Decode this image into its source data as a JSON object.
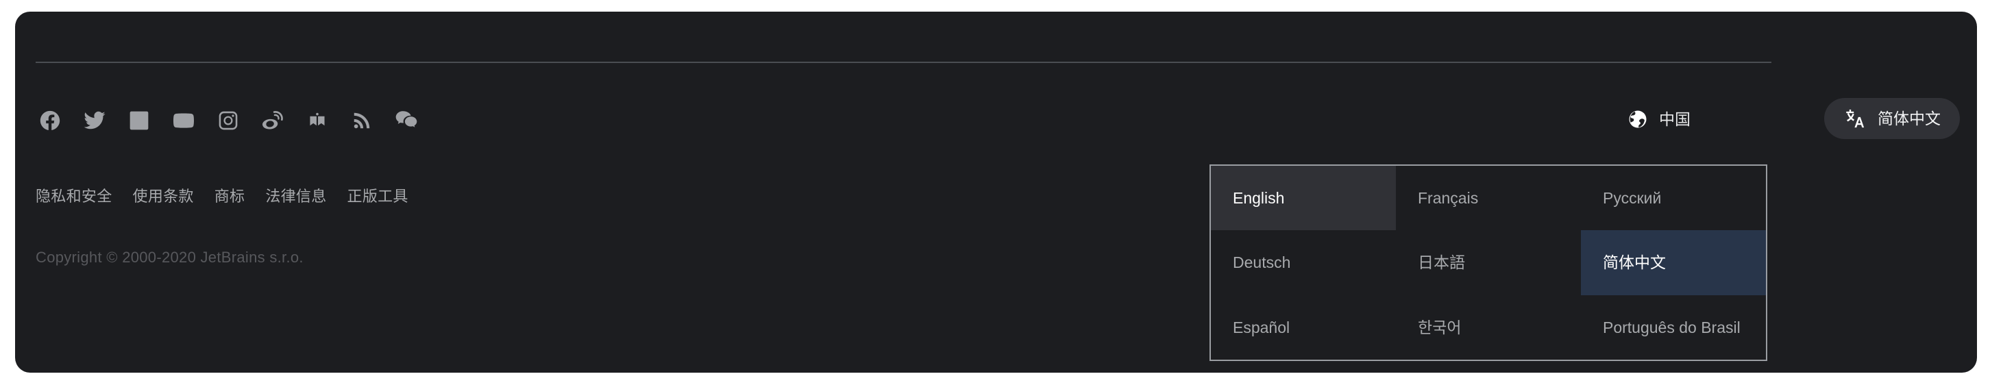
{
  "footer": {
    "social_links": [
      {
        "name": "facebook-icon",
        "label": "Facebook"
      },
      {
        "name": "twitter-icon",
        "label": "Twitter"
      },
      {
        "name": "linkedin-icon",
        "label": "LinkedIn"
      },
      {
        "name": "youtube-icon",
        "label": "YouTube"
      },
      {
        "name": "instagram-icon",
        "label": "Instagram"
      },
      {
        "name": "weibo-icon",
        "label": "Weibo"
      },
      {
        "name": "zhihu-icon",
        "label": "Zhihu"
      },
      {
        "name": "rss-icon",
        "label": "RSS"
      },
      {
        "name": "wechat-icon",
        "label": "WeChat"
      }
    ],
    "legal_links": [
      "隐私和安全",
      "使用条款",
      "商标",
      "法律信息",
      "正版工具"
    ],
    "copyright": "Copyright © 2000-2020 JetBrains s.r.o."
  },
  "region": {
    "icon": "globe-icon",
    "label": "中国"
  },
  "language_button": {
    "icon": "translate-icon",
    "label": "简体中文"
  },
  "language_dropdown": {
    "options": [
      {
        "label": "English",
        "state": "hovered"
      },
      {
        "label": "Français",
        "state": "default"
      },
      {
        "label": "Русский",
        "state": "default"
      },
      {
        "label": "Deutsch",
        "state": "default"
      },
      {
        "label": "日本語",
        "state": "default"
      },
      {
        "label": "简体中文",
        "state": "selected"
      },
      {
        "label": "Español",
        "state": "default"
      },
      {
        "label": "한국어",
        "state": "default"
      },
      {
        "label": "Português do Brasil",
        "state": "default"
      }
    ]
  },
  "colors": {
    "panel_background": "#1c1d20",
    "page_background": "#ffffff",
    "divider": "#4a4d52",
    "icon_gray": "#a0a2a6",
    "link_gray": "#a8aaad",
    "copyright_gray": "#57585c",
    "pill_background": "#303136",
    "selected_blue": "#28354a",
    "dropdown_border": "#9a9da2",
    "text_white": "#ffffff"
  }
}
